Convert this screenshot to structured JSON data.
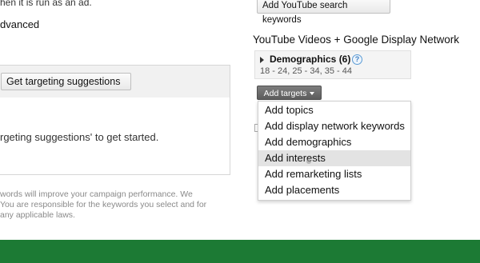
{
  "left": {
    "line1": "hen it is run as an ad.",
    "line2": "dvanced",
    "get_suggestions_label": "Get targeting suggestions",
    "hint": "rgeting suggestions' to get started.",
    "disclaimer_lines": [
      "words will improve your campaign performance. We",
      "You are responsible for the keywords you select and for",
      "any applicable laws."
    ]
  },
  "right": {
    "add_youtube_label": "Add YouTube search keywords",
    "network_title": "YouTube Videos + Google Display Network",
    "demographics": {
      "label": "Demographics (6)",
      "help": "?",
      "values": "18 - 24, 25 - 34, 35 - 44"
    },
    "add_targets_label": "Add targets",
    "menu_items": [
      "Add topics",
      "Add display network keywords",
      "Add demographics",
      "Add interests",
      "Add remarketing lists",
      "Add placements"
    ]
  },
  "colors": {
    "footer_green": "#1c7a34",
    "menu_hover": "#e3e3e3"
  }
}
